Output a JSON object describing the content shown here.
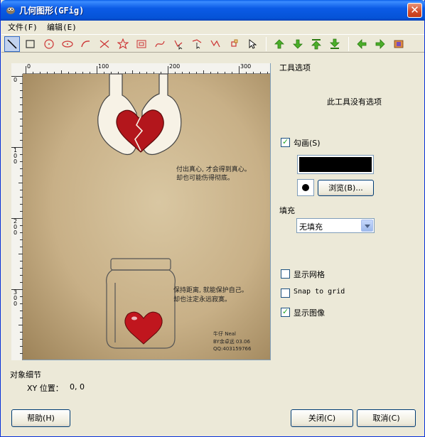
{
  "window": {
    "title": "几何图形(GFig)"
  },
  "menu": [
    "文件(F)",
    "编辑(E)"
  ],
  "toolbar": {
    "tools": [
      {
        "icon": "line-icon"
      },
      {
        "icon": "rectangle-icon"
      },
      {
        "icon": "circle-icon"
      },
      {
        "icon": "ellipse-icon"
      },
      {
        "icon": "arc-icon"
      },
      {
        "icon": "polygon-icon"
      },
      {
        "icon": "star-icon"
      },
      {
        "icon": "spiral-icon"
      },
      {
        "icon": "bezier-icon"
      },
      {
        "icon": "move-object-icon"
      },
      {
        "icon": "move-point-icon"
      },
      {
        "icon": "copy-object-icon"
      },
      {
        "icon": "delete-object-icon"
      },
      {
        "icon": "select-object-icon"
      }
    ],
    "nav": [
      {
        "icon": "raise-icon"
      },
      {
        "icon": "lower-icon"
      },
      {
        "icon": "raise-to-top-icon"
      },
      {
        "icon": "lower-to-bottom-icon"
      },
      {
        "icon": "prev-object-icon"
      },
      {
        "icon": "next-object-icon"
      },
      {
        "icon": "show-all-objects-icon"
      }
    ]
  },
  "ruler": {
    "h_labels": [
      "0",
      "100",
      "200",
      "300"
    ],
    "v_labels": [
      "0",
      "100",
      "200",
      "300"
    ]
  },
  "canvas_image": {
    "text1_line1": "付出真心, 才会得到真心。",
    "text1_line2": "却也可能伤得彻底。",
    "text2_line1": "保持距离, 就能保护自己。",
    "text2_line2": "却也注定永远寂寞。",
    "sig1": "牛仔 Neal",
    "sig2": "BY余卓远 03.06",
    "sig3": "QQ:403159766"
  },
  "options": {
    "title": "工具选项",
    "no_options": "此工具没有选项",
    "stroke_label": "勾画(S)",
    "stroke_checked": true,
    "stroke_color": "#000000",
    "browse_label": "浏览(B)...",
    "fill_label": "填充",
    "fill_value": "无填充",
    "show_grid_label": "显示网格",
    "show_grid_checked": false,
    "snap_label": "Snap to grid",
    "snap_checked": false,
    "show_image_label": "显示图像",
    "show_image_checked": true
  },
  "details": {
    "title": "对象细节",
    "xy_label": "XY 位置：",
    "xy_value": "0, 0"
  },
  "buttons": {
    "help": "帮助(H)",
    "close": "关闭(C)",
    "cancel": "取消(C)"
  }
}
